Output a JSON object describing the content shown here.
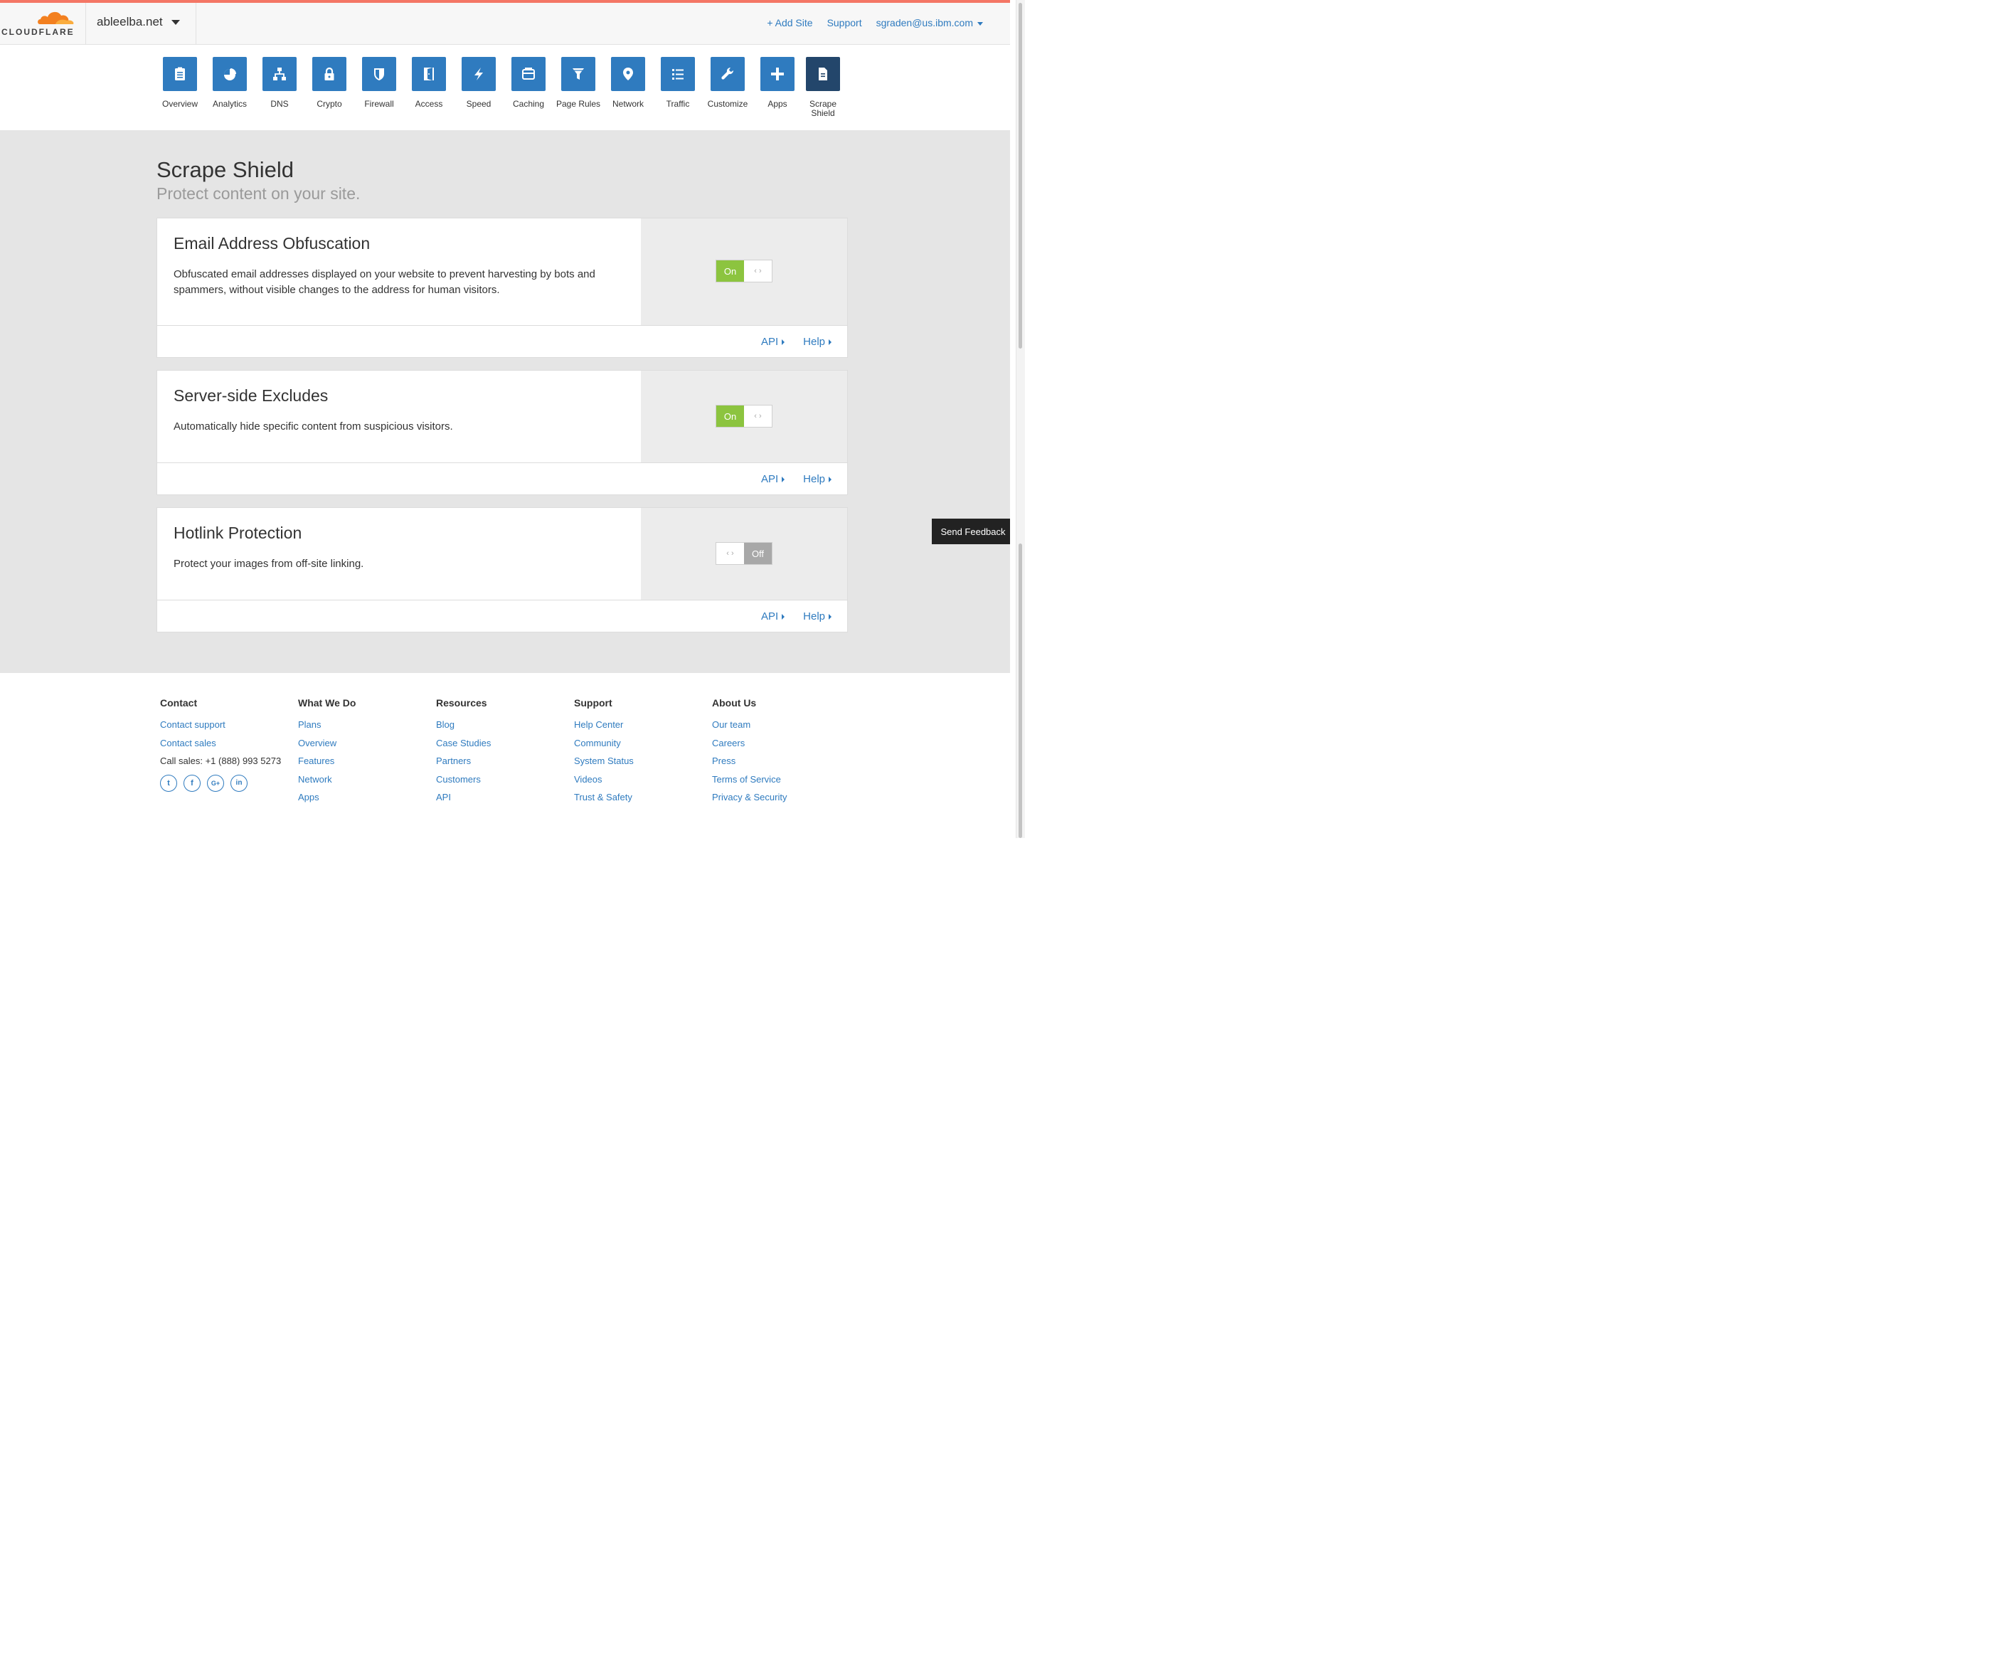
{
  "header": {
    "logo_text": "CLOUDFLARE",
    "site_name": "ableelba.net",
    "add_site": "+ Add Site",
    "support": "Support",
    "user": "sgraden@us.ibm.com"
  },
  "nav": {
    "items": [
      {
        "label": "Overview",
        "icon": "clipboard-icon"
      },
      {
        "label": "Analytics",
        "icon": "pie-chart-icon"
      },
      {
        "label": "DNS",
        "icon": "network-tree-icon"
      },
      {
        "label": "Crypto",
        "icon": "lock-icon"
      },
      {
        "label": "Firewall",
        "icon": "shield-icon"
      },
      {
        "label": "Access",
        "icon": "door-icon"
      },
      {
        "label": "Speed",
        "icon": "lightning-icon"
      },
      {
        "label": "Caching",
        "icon": "server-icon"
      },
      {
        "label": "Page Rules",
        "icon": "filter-icon"
      },
      {
        "label": "Network",
        "icon": "map-pin-icon"
      },
      {
        "label": "Traffic",
        "icon": "list-icon"
      },
      {
        "label": "Customize",
        "icon": "wrench-icon"
      },
      {
        "label": "Apps",
        "icon": "plus-icon"
      },
      {
        "label": "Scrape Shield",
        "icon": "document-icon"
      }
    ],
    "active": "Scrape Shield"
  },
  "page": {
    "title": "Scrape Shield",
    "subtitle": "Protect content on your site."
  },
  "cards": [
    {
      "title": "Email Address Obfuscation",
      "description": "Obfuscated email addresses displayed on your website to prevent harvesting by bots and spammers, without visible changes to the address for human visitors.",
      "state": "On",
      "api": "API",
      "help": "Help"
    },
    {
      "title": "Server-side Excludes",
      "description": "Automatically hide specific content from suspicious visitors.",
      "state": "On",
      "api": "API",
      "help": "Help"
    },
    {
      "title": "Hotlink Protection",
      "description": "Protect your images from off-site linking.",
      "state": "Off",
      "api": "API",
      "help": "Help"
    }
  ],
  "toggle_blank_glyph": "‹ ›",
  "feedback": "Send Feedback",
  "footer": {
    "contact": {
      "heading": "Contact",
      "links": [
        "Contact support",
        "Contact sales"
      ],
      "phone": "Call sales: +1 (888) 993 5273",
      "socials": [
        {
          "name": "twitter-icon",
          "glyph": "t"
        },
        {
          "name": "facebook-icon",
          "glyph": "f"
        },
        {
          "name": "google-plus-icon",
          "glyph": "G+"
        },
        {
          "name": "linkedin-icon",
          "glyph": "in"
        }
      ]
    },
    "what_we_do": {
      "heading": "What We Do",
      "links": [
        "Plans",
        "Overview",
        "Features",
        "Network",
        "Apps"
      ]
    },
    "resources": {
      "heading": "Resources",
      "links": [
        "Blog",
        "Case Studies",
        "Partners",
        "Customers",
        "API"
      ]
    },
    "support": {
      "heading": "Support",
      "links": [
        "Help Center",
        "Community",
        "System Status",
        "Videos",
        "Trust & Safety"
      ]
    },
    "about": {
      "heading": "About Us",
      "links": [
        "Our team",
        "Careers",
        "Press",
        "Terms of Service",
        "Privacy & Security"
      ]
    }
  },
  "colors": {
    "accent_blue": "#2f7bbf",
    "active_tile": "#23466b",
    "toggle_on": "#8cc43f",
    "toggle_off": "#a8a8a8",
    "top_line": "#f47665",
    "brand_orange": "#f38020"
  }
}
